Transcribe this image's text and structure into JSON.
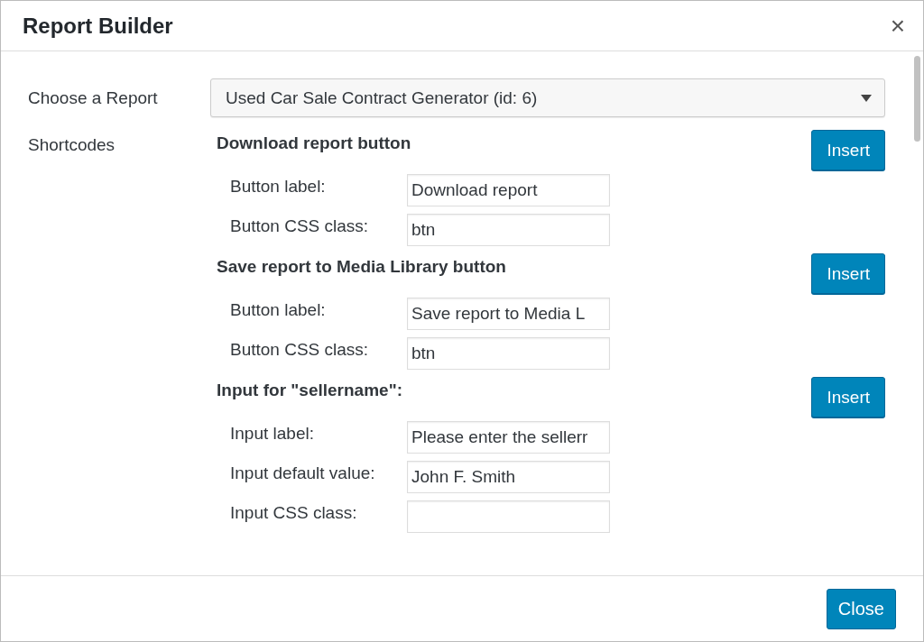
{
  "window": {
    "title": "Report Builder",
    "close": "×"
  },
  "report": {
    "label": "Choose a Report",
    "value": "Used Car Sale Contract Generator (id: 6)"
  },
  "shortcodes_label": "Shortcodes",
  "sections": [
    {
      "title": "Download report button",
      "button": "Insert",
      "fields": [
        {
          "label": "Button label:",
          "value": "Download report"
        },
        {
          "label": "Button CSS class:",
          "value": "btn"
        }
      ]
    },
    {
      "title": "Save report to Media Library button",
      "button": "Insert",
      "fields": [
        {
          "label": "Button label:",
          "value": "Save report to Media L"
        },
        {
          "label": "Button CSS class:",
          "value": "btn"
        }
      ]
    },
    {
      "title": "**Input for \"**sellername**\":**",
      "button": "Insert",
      "fields": [
        {
          "label": "Input label:",
          "value": "Please enter the sellerr"
        },
        {
          "label": "Input default value:",
          "value": "John F. Smith"
        },
        {
          "label": "Input CSS class:"
        }
      ]
    }
  ],
  "footer": {
    "button": "Close"
  }
}
